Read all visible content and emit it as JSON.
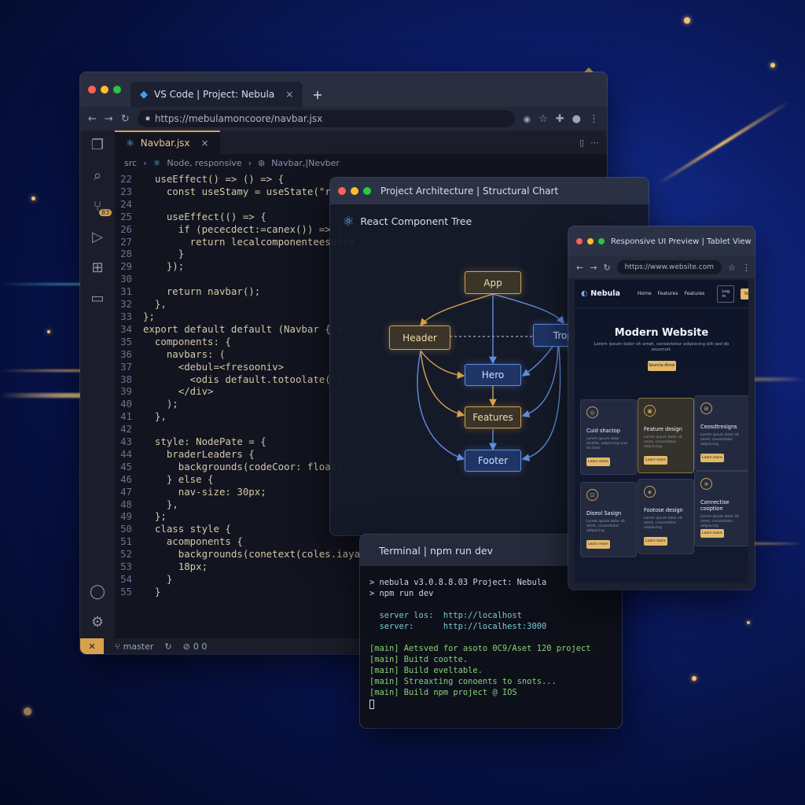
{
  "vscode": {
    "tab_title": "VS Code | Project: Nebula",
    "tab_close": "×",
    "new_tab": "+",
    "url": "https://mebulamoncoore/navbar.jsx",
    "file_tab": "Navbar.jsx",
    "file_close": "×",
    "breadcrumb": [
      "src",
      "Node, responsive",
      "Navbar,|Nevber"
    ],
    "lines": [
      {
        "n": "22",
        "t": "  useEffect() => () => {"
      },
      {
        "n": "23",
        "t": "    const useStamy = useState(\"react"
      },
      {
        "n": "24",
        "t": ""
      },
      {
        "n": "25",
        "t": "    useEffect(() => {"
      },
      {
        "n": "26",
        "t": "      if (pececdect:=canex()) => {"
      },
      {
        "n": "27",
        "t": "        return lecalcomponenteesoctd"
      },
      {
        "n": "28",
        "t": "      }"
      },
      {
        "n": "29",
        "t": "    });"
      },
      {
        "n": "30",
        "t": ""
      },
      {
        "n": "31",
        "t": "    return navbar();"
      },
      {
        "n": "32",
        "t": "  },"
      },
      {
        "n": "33",
        "t": "};"
      },
      {
        "n": "34",
        "t": "export default default (Navbar { ="
      },
      {
        "n": "35",
        "t": "  components: {"
      },
      {
        "n": "36",
        "t": "    navbars: ("
      },
      {
        "n": "37",
        "t": "      <debul=<fresooniv>"
      },
      {
        "n": "38",
        "t": "        <odis default.totoolate(\"r"
      },
      {
        "n": "39",
        "t": "      </div>"
      },
      {
        "n": "40",
        "t": "    );"
      },
      {
        "n": "41",
        "t": "  },"
      },
      {
        "n": "42",
        "t": ""
      },
      {
        "n": "43",
        "t": "  style: NodePate = {"
      },
      {
        "n": "44",
        "t": "    braderLeaders {"
      },
      {
        "n": "45",
        "t": "      backgrounds(codeCoor: floati"
      },
      {
        "n": "46",
        "t": "    } else {"
      },
      {
        "n": "47",
        "t": "      nav-size: 30px;"
      },
      {
        "n": "48",
        "t": "    },"
      },
      {
        "n": "49",
        "t": "  };"
      },
      {
        "n": "50",
        "t": "  class style {"
      },
      {
        "n": "51",
        "t": "    acomponents {"
      },
      {
        "n": "52",
        "t": "      backgrounds(conetext(coles.iayasti"
      },
      {
        "n": "53",
        "t": "      18px;"
      },
      {
        "n": "54",
        "t": "    }"
      },
      {
        "n": "55",
        "t": "  }"
      }
    ],
    "status_branch": "master",
    "status_problems": "0 0",
    "colors": {
      "accent": "#d8a24a",
      "bg": "#121420"
    }
  },
  "arch": {
    "title": "Project Architecture | Structural Chart",
    "subtitle": "React Component Tree",
    "nodes": {
      "app": "App",
      "header": "Header",
      "trop": "Trop",
      "hero": "Hero",
      "features": "Features",
      "footer": "Footer"
    }
  },
  "terminal": {
    "title": "Terminal | npm run dev",
    "lines": [
      "> nebula v3.0.8.8.03 Project: Nebula",
      "> npm run dev",
      "",
      "  server los:  http://localhost",
      "  server:      http://localhest:3000",
      "",
      "[main] Aetsved for asoto 0C9/Aset 120 project",
      "[main] Buitd cootte.",
      "[main] Build eveltable.",
      "[main] Streaxting conoents to snots...",
      "[main] Build npm project @ IOS"
    ]
  },
  "preview": {
    "title": "Responsive UI Preview | Tablet View",
    "url": "https://www.website.com",
    "logo": "Nebula",
    "nav": [
      "Home",
      "Features",
      "Features"
    ],
    "login": "Log in",
    "navigation": "Navigation",
    "hero_title": "Modern Website",
    "hero_sub": "Lorem ipsum dolor sit amet, consectetur adipiscing elit sed do eiusmod.",
    "cta": "Sevrcta Ahne",
    "cards": [
      {
        "title": "Cuid shactop",
        "text": "Lorem ipsum dolor shuttle, adipiscing cras et dolor",
        "btn": "Learn more",
        "icon": "◎"
      },
      {
        "title": "Feature design",
        "text": "Lorem ipsum dolor sit amet, consectetur adipiscing",
        "btn": "Learn more",
        "icon": "▣"
      },
      {
        "title": "Ceosdtresigns",
        "text": "Lorem ipsum dolor sit amet, consectetur adipiscing",
        "btn": "Learn more",
        "icon": "⊞"
      },
      {
        "title": "Diseol Sasign",
        "text": "Lorem ipsum dolor sit amet, consectetur adipiscing",
        "btn": "Learn more",
        "icon": "⊡"
      },
      {
        "title": "Footose design",
        "text": "Lorem ipsum dolor sit amet, consectetur adipiscing",
        "btn": "Learn more",
        "icon": "◈"
      },
      {
        "title": "Connectise cooption",
        "text": "Lorem ipsum dolor sit amet, consectetur adipiscing",
        "btn": "Learn more",
        "icon": "⊕"
      }
    ]
  }
}
